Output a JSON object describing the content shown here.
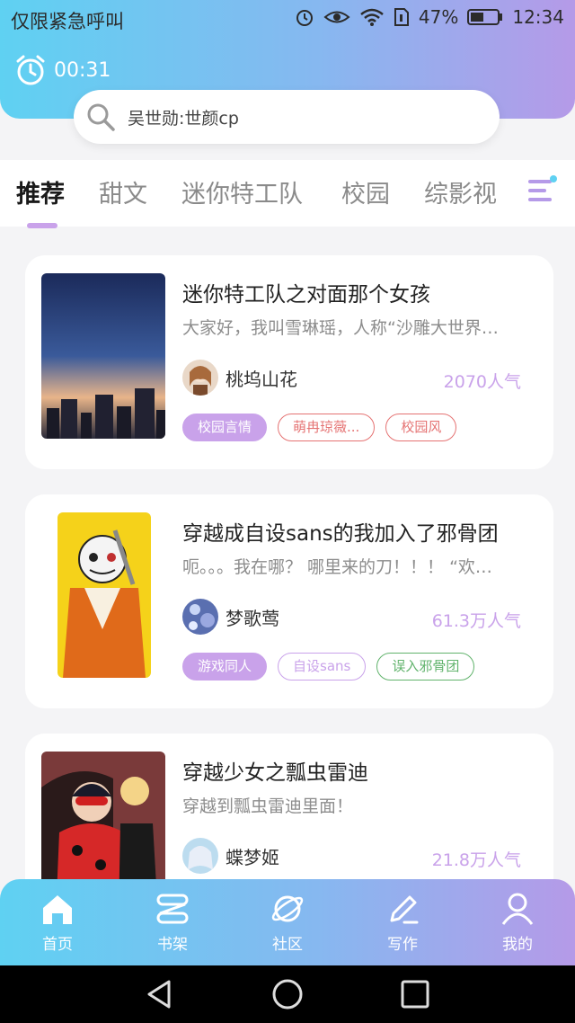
{
  "status_bar": {
    "carrier": "仅限紧急呼叫",
    "battery": "47%",
    "time": "12:34"
  },
  "timer": {
    "value": "00:31"
  },
  "search": {
    "text": "吴世勋:世颜cp"
  },
  "tabs": [
    {
      "label": "推荐",
      "active": true
    },
    {
      "label": "甜文"
    },
    {
      "label": "迷你特工队"
    },
    {
      "label": "校园"
    },
    {
      "label": "综影视"
    }
  ],
  "books": [
    {
      "title": "迷你特工队之对面那个女孩",
      "description": "大家好，我叫雪琳瑶，人称“沙雕大世界…",
      "author": "桃坞山花",
      "popularity": "2070人气",
      "tags": [
        {
          "label": "校园言情",
          "style": "fill"
        },
        {
          "label": "萌冉琼薇...",
          "style": "red"
        },
        {
          "label": "校园风",
          "style": "red"
        }
      ]
    },
    {
      "title": "穿越成自设sans的我加入了邪骨团",
      "description": "呃。。。我在哪？ 哪里来的刀！！！ “欢…",
      "author": "梦歌莺",
      "popularity": "61.3万人气",
      "tags": [
        {
          "label": "游戏同人",
          "style": "fill"
        },
        {
          "label": "自设sans",
          "style": "purple"
        },
        {
          "label": "误入邪骨团",
          "style": "green"
        }
      ]
    },
    {
      "title": "穿越少女之瓢虫雷迪",
      "description": "穿越到瓢虫雷迪里面！",
      "author": "蝶梦姬",
      "popularity": "21.8万人气",
      "tags": []
    }
  ],
  "bottom_nav": [
    {
      "label": "首页",
      "icon": "home-icon"
    },
    {
      "label": "书架",
      "icon": "bookshelf-icon"
    },
    {
      "label": "社区",
      "icon": "planet-icon"
    },
    {
      "label": "写作",
      "icon": "pen-icon"
    },
    {
      "label": "我的",
      "icon": "user-icon"
    }
  ],
  "colors": {
    "accent": "#c9a2ea",
    "gradient_start": "#5fd1f2",
    "gradient_end": "#b59ae8"
  }
}
